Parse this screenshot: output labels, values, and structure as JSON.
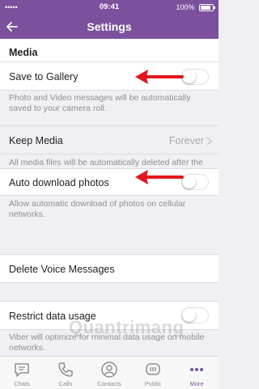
{
  "status_bar": {
    "carrier": "•••••",
    "time": "09:41",
    "battery": "100%"
  },
  "header": {
    "title": "Settings",
    "back_icon": "back-arrow-icon"
  },
  "sections": {
    "media_header": "Media",
    "save_gallery": {
      "label": "Save to Gallery",
      "enabled": false
    },
    "save_gallery_note": "Photo and Video messages will be automatically saved to your camera roll.",
    "keep_media": {
      "label": "Keep Media",
      "value": "Forever"
    },
    "keep_media_note": "All media files will be automatically deleted after the selected period of time.",
    "auto_download": {
      "label": "Auto download photos",
      "enabled": false
    },
    "auto_download_note": "Allow automatic download of photos on cellular networks.",
    "delete_voice": {
      "label": "Delete Voice Messages"
    },
    "restrict_data": {
      "label": "Restrict data usage",
      "enabled": false
    },
    "restrict_data_note": "Viber will optimize for minimal data usage on mobile networks."
  },
  "tabs": [
    {
      "label": "Chats",
      "icon": "chat-icon",
      "active": false
    },
    {
      "label": "Calls",
      "icon": "phone-icon",
      "active": false
    },
    {
      "label": "Contacts",
      "icon": "contacts-icon",
      "active": false
    },
    {
      "label": "Public",
      "icon": "public-icon",
      "active": false
    },
    {
      "label": "More",
      "icon": "more-icon",
      "active": true
    }
  ],
  "colors": {
    "brand": "#7b519d",
    "arrow": "#e3141c",
    "background": "#efeff4"
  },
  "watermark": "Quantrimang"
}
